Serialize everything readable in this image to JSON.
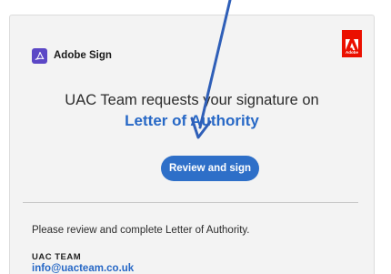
{
  "email": {
    "brand": {
      "name": "Adobe Sign",
      "icon": "adobe-sign-icon"
    },
    "logo": {
      "text": "Adobe",
      "color": "#eb1000",
      "icon": "adobe-logo-icon"
    },
    "request_line": "UAC Team requests your signature on",
    "document_title": "Letter of Authority",
    "cta_label": "Review and sign",
    "body_text": "Please review and complete Letter of Authority.",
    "sender": {
      "name": "UAC TEAM",
      "email": "info@uacteam.co.uk"
    }
  },
  "colors": {
    "accent": "#2e6fc8",
    "link": "#2768c6",
    "card_background": "#f3f3f3",
    "annotation_arrow": "#2f5fb8"
  }
}
